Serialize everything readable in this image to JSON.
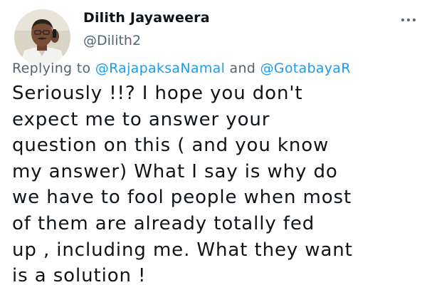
{
  "tweet": {
    "author": {
      "display_name": "Dilith Jayaweera",
      "handle": "@Dilith2"
    },
    "more_icon": "ellipsis-icon",
    "reply_context": {
      "prefix": "Replying to",
      "mention_1": "@RajapaksaNamal",
      "conjunction": "and",
      "mention_2": "@GotabayaR"
    },
    "text_lines": [
      "Seriously !!? I hope you don't",
      "expect me to answer your",
      "question on this ( and you know",
      "my answer) What I say is why do",
      "we have to fool people when most",
      "of them are already totally fed",
      "up , including me. What they want",
      "is a solution !"
    ]
  },
  "colors": {
    "text": "#0f1419",
    "secondary": "#536471",
    "link": "#1d9bf0"
  }
}
